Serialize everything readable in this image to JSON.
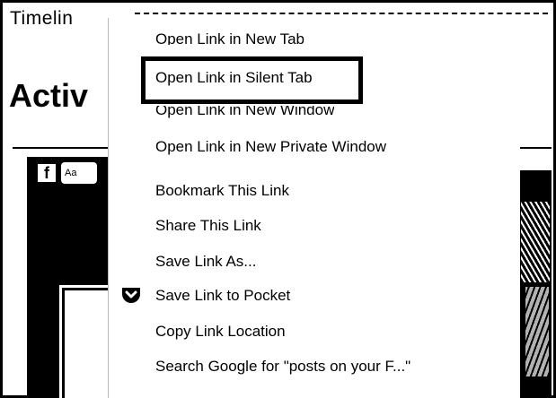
{
  "window": {
    "tab_label": "Timelin"
  },
  "page": {
    "section_title": "Activ",
    "fb_letter": "f",
    "fb_chip_text": "Aa"
  },
  "context_menu": {
    "items": [
      {
        "label": "Open Link in New Tab"
      },
      {
        "label": "Open Link in Silent Tab"
      },
      {
        "label": "Open Link in New Window"
      },
      {
        "label": "Open Link in New Private Window"
      },
      {
        "label": "Bookmark This Link"
      },
      {
        "label": "Share This Link"
      },
      {
        "label": "Save Link As..."
      },
      {
        "label": "Save Link to Pocket",
        "icon": "pocket-icon"
      },
      {
        "label": "Copy Link Location"
      },
      {
        "label": "Search Google for \"posts on your F...\""
      }
    ],
    "highlighted_index": 1
  }
}
